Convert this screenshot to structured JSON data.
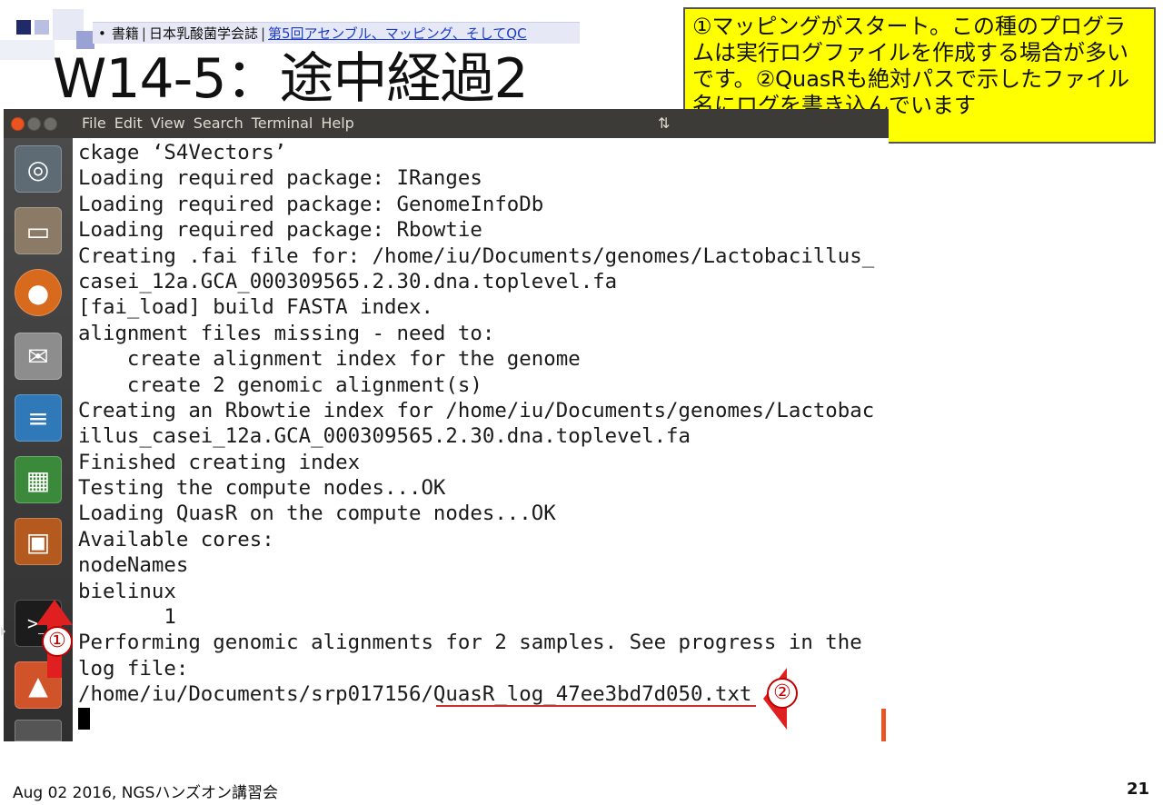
{
  "slide": {
    "reference": {
      "bullet": "•",
      "part1": "書籍",
      "separator": "|",
      "part2": "日本乳酸菌学会誌",
      "link": "第5回アセンブル、マッピング、そしてQC"
    },
    "title": "W14-5：途中経過2",
    "callout": "①マッピングがスタート。この種のプログラムは実行ログファイルを作成する場合が多いです。②QuasRも絶対パスで示したファイル名にログを書き込んでいます",
    "footer": "Aug 02 2016, NGSハンズオン講習会",
    "page_number": "21"
  },
  "markers": {
    "m1": "①",
    "m2": "②"
  },
  "terminal": {
    "menu": [
      "File",
      "Edit",
      "View",
      "Search",
      "Terminal",
      "Help"
    ],
    "network_icon": "⇅",
    "lines": [
      "ckage ‘S4Vectors’",
      "Loading required package: IRanges",
      "Loading required package: GenomeInfoDb",
      "Loading required package: Rbowtie",
      "Creating .fai file for: /home/iu/Documents/genomes/Lactobacillus_",
      "casei_12a.GCA_000309565.2.30.dna.toplevel.fa",
      "[fai_load] build FASTA index.",
      "alignment files missing - need to:",
      "    create alignment index for the genome",
      "    create 2 genomic alignment(s)",
      "Creating an Rbowtie index for /home/iu/Documents/genomes/Lactobac",
      "illus_casei_12a.GCA_000309565.2.30.dna.toplevel.fa",
      "Finished creating index",
      "Testing the compute nodes...OK",
      "Loading QuasR on the compute nodes...OK",
      "Available cores:",
      "nodeNames",
      "bielinux",
      "       1",
      "Performing genomic alignments for 2 samples. See progress in the",
      "log file:",
      "/home/iu/Documents/srp017156/QuasR_log_47ee3bd7d050.txt"
    ]
  },
  "launcher": {
    "icons": [
      "ubuntu-dash-icon",
      "files-icon",
      "firefox-icon",
      "mail-icon",
      "writer-icon",
      "calc-icon",
      "impress-icon",
      "terminal-icon",
      "software-center-icon",
      "trash-icon"
    ]
  }
}
